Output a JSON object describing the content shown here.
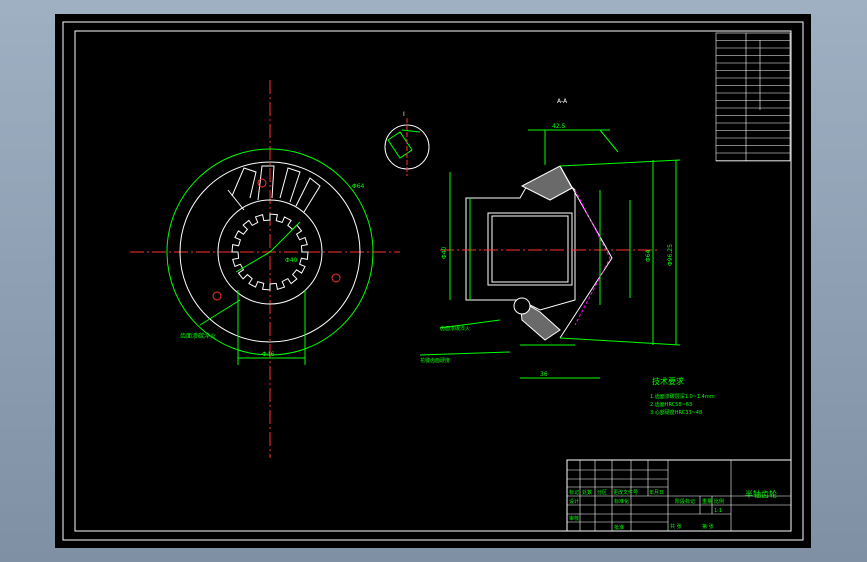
{
  "title_block": {
    "drawing_name": "半轴齿轮",
    "row_label_1": "标记",
    "row_label_2": "处数",
    "row_label_3": "分区",
    "row_label_4": "更改文件号",
    "row_label_5": "签名",
    "row_label_6": "年月日",
    "design": "设计",
    "review": "审核",
    "process": "工艺",
    "approve": "批准",
    "std": "标准化",
    "stage": "阶段标记",
    "weight": "重量",
    "scale": "比例",
    "scale_value": "1:1",
    "sheet_total": "共 张",
    "sheet_no": "第 张"
  },
  "tech_requirements": {
    "heading": "技术要求",
    "line1": "1.齿面渗碳层深1.0~1.4mm",
    "line2": "2.齿面HRC58~63",
    "line3": "3.心部硬度HRC33~48"
  },
  "views": {
    "section_label": "A-A",
    "detail_label": "I",
    "dim_big": "Φ96.25",
    "dim_mid": "Φ64",
    "dim_bore": "Φ40",
    "dim_spline": "Φ46",
    "dim_width": "36",
    "dim_len": "42.5",
    "note1": "齿面渗碳淬火",
    "note2": "花键齿面硬度",
    "scale_note": "1:1"
  },
  "colors": {
    "paper": "#000000",
    "line_white": "#ffffff",
    "dim_green": "#00ff00",
    "center_red": "#ff3030",
    "accent_magenta": "#ff00ff"
  }
}
